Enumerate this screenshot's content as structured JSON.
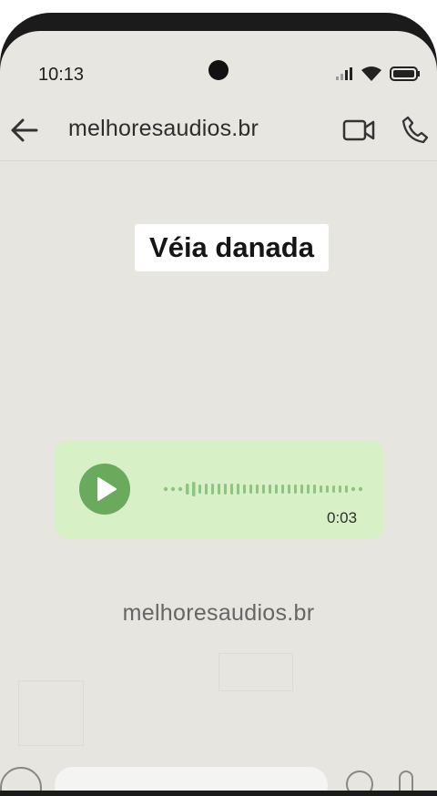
{
  "status_bar": {
    "time": "10:13"
  },
  "header": {
    "contact_name": "melhoresaudios.br"
  },
  "chat": {
    "title": "Véia danada",
    "audio_message": {
      "duration": "0:03"
    },
    "watermark": "melhoresaudios.br"
  },
  "icons": {
    "back": "arrow-left-icon",
    "video": "video-call-icon",
    "call": "phone-icon",
    "play": "play-icon",
    "signal": "signal-icon",
    "wifi": "wifi-icon",
    "battery": "battery-icon"
  },
  "colors": {
    "screen_bg": "#e7e6e1",
    "bubble_bg": "#d8f0c6",
    "play_button": "#6aaa5d",
    "wave_dots": "#8ec47f"
  }
}
